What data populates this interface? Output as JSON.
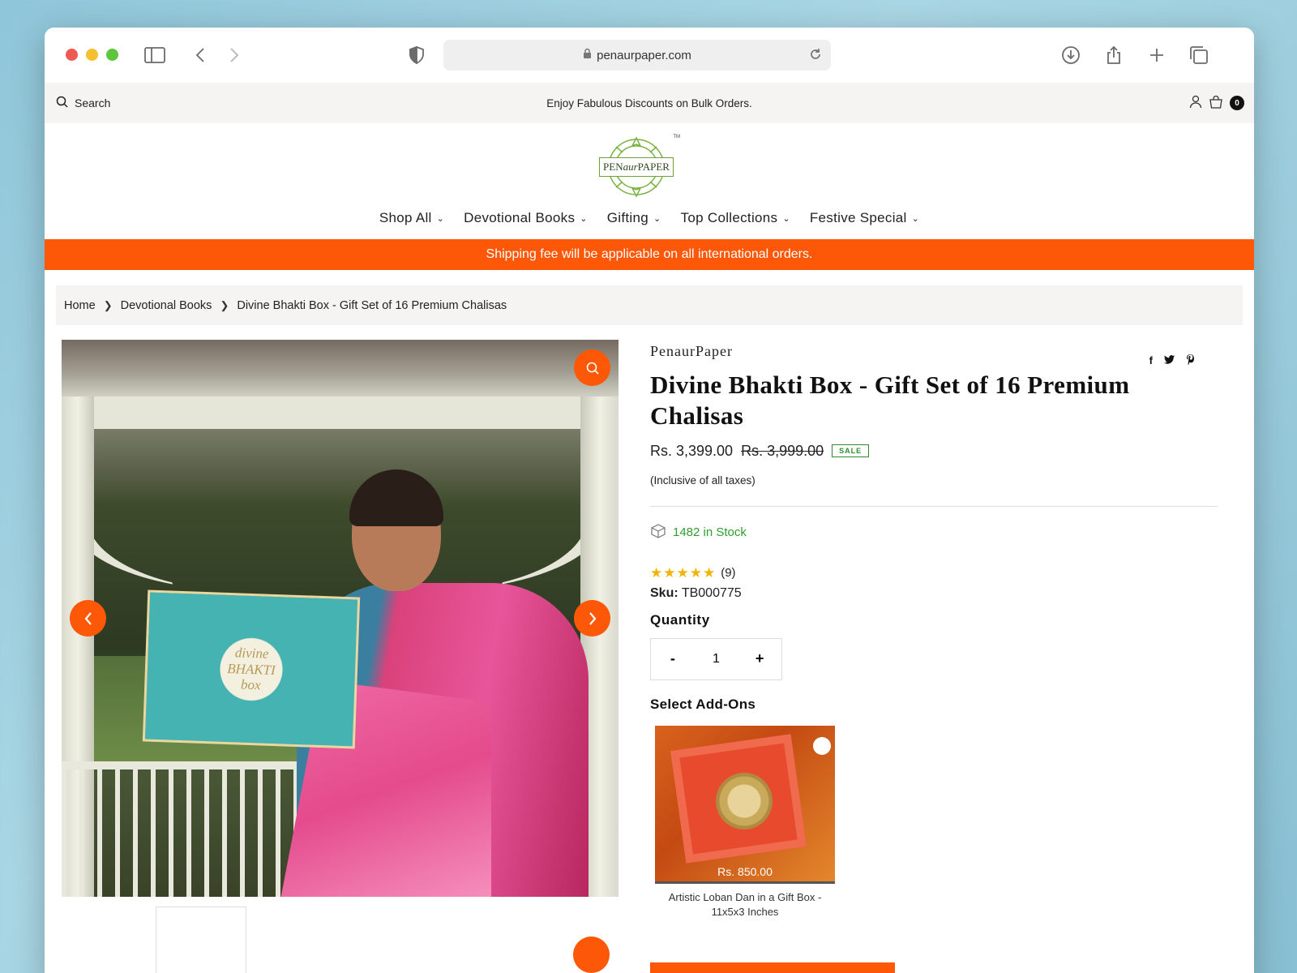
{
  "browser": {
    "url": "penaurpaper.com"
  },
  "topbar": {
    "search_label": "Search",
    "announcement": "Enjoy Fabulous Discounts on Bulk Orders.",
    "cart_count": "0"
  },
  "logo": {
    "text_pre": "PEN",
    "text_mid": "aur",
    "text_post": "PAPER",
    "tm": "TM"
  },
  "nav": {
    "items": [
      {
        "label": "Shop All"
      },
      {
        "label": "Devotional Books"
      },
      {
        "label": "Gifting"
      },
      {
        "label": "Top Collections"
      },
      {
        "label": "Festive Special"
      }
    ]
  },
  "promo": {
    "text": "Shipping fee will be applicable on all international orders."
  },
  "breadcrumb": {
    "items": [
      "Home",
      "Devotional Books",
      "Divine Bhakti Box - Gift Set of 16 Premium Chalisas"
    ]
  },
  "gallery": {
    "box_line1": "divine",
    "box_line2": "BHAKTI",
    "box_line3": "box"
  },
  "product": {
    "brand": "PenaurPaper",
    "title": "Divine Bhakti Box - Gift Set of 16 Premium Chalisas",
    "price": "Rs. 3,399.00",
    "compare_price": "Rs. 3,999.00",
    "badge": "SALE",
    "tax_note": "(Inclusive of all taxes)",
    "stock": "1482 in Stock",
    "rating_stars": 5,
    "review_count": "(9)",
    "sku_label": "Sku:",
    "sku_value": "TB000775",
    "quantity_label": "Quantity",
    "qty_minus": "-",
    "qty_value": "1",
    "qty_plus": "+",
    "addons_label": "Select Add-Ons"
  },
  "addon": {
    "price": "Rs. 850.00",
    "name": "Artistic Loban Dan in a Gift Box - 11x5x3 Inches"
  },
  "colors": {
    "accent": "#fc5808",
    "success": "#2e9e2e",
    "star": "#f5b301"
  }
}
